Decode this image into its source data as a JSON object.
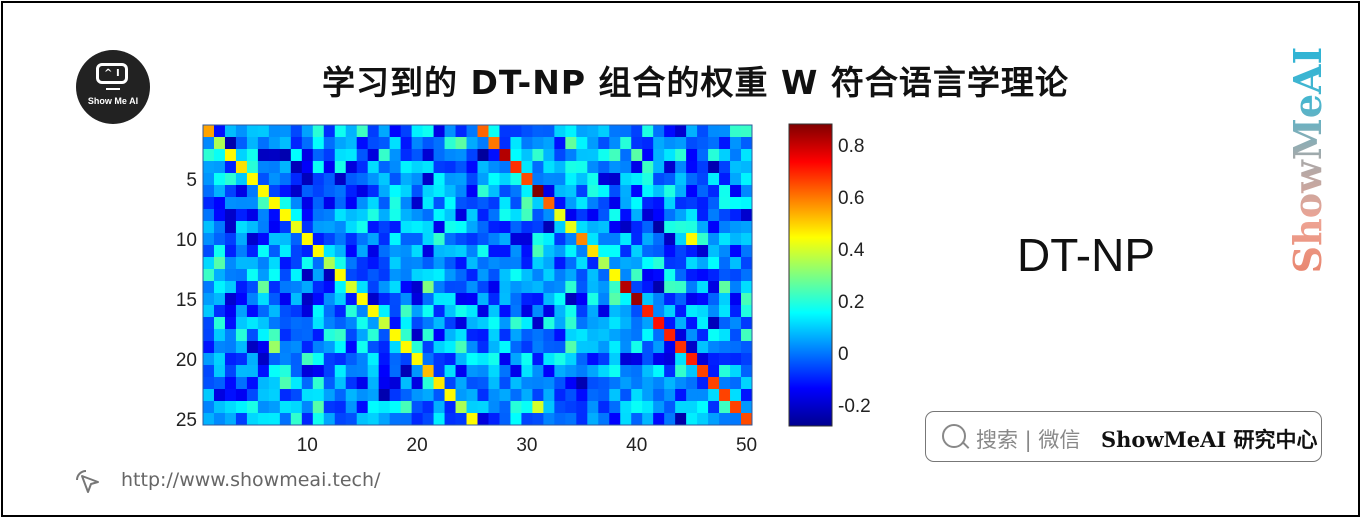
{
  "page": {
    "title": "学习到的 DT-NP 组合的权重 W 符合语言学理论",
    "side_label": "DT-NP",
    "brand_vertical": "ShowMeAI",
    "logo_text": "Show Me AI",
    "logo_face": "^ I",
    "search_hint": "搜索 | 微信",
    "search_name": "ShowMeAI 研究中心",
    "url": "http://www.showmeai.tech/",
    "icons": {
      "logo": "robot-monitor-icon",
      "search": "search-icon",
      "cursor": "cursor-click-icon"
    }
  },
  "chart_data": {
    "type": "heatmap",
    "title": "",
    "xlabel": "",
    "ylabel": "",
    "rows": 25,
    "cols": 50,
    "xticks": [
      10,
      20,
      30,
      40,
      50
    ],
    "yticks": [
      5,
      10,
      15,
      20,
      25
    ],
    "colorbar": {
      "colormap": "jet",
      "range": [
        -0.28,
        0.88
      ],
      "ticks": [
        0.8,
        0.6,
        0.4,
        0.2,
        0,
        -0.2
      ]
    },
    "diagonal_left": [
      0.55,
      0.35,
      0.45,
      0.48,
      0.45,
      0.45,
      0.45,
      0.45,
      0.42,
      0.45,
      0.45,
      0.35,
      0.45,
      0.4,
      0.45,
      0.45,
      0.38,
      0.45,
      0.45,
      0.45,
      0.52,
      0.47,
      0.45,
      0.35,
      0.45
    ],
    "diagonal_right": [
      0.62,
      0.6,
      0.82,
      0.68,
      0.65,
      0.88,
      0.62,
      0.42,
      0.42,
      0.58,
      0.48,
      0.35,
      0.45,
      0.82,
      0.85,
      0.7,
      0.72,
      0.7,
      0.68,
      0.7,
      0.66,
      0.66,
      0.66,
      0.66,
      0.65
    ],
    "offdiag_seed": 7,
    "offdiag_range": [
      -0.25,
      0.3
    ],
    "notable_cells": [
      {
        "row": 10,
        "col": 45,
        "value": 0.45
      },
      {
        "row": 19,
        "col": 7,
        "value": 0.33
      },
      {
        "row": 25,
        "col": 25,
        "value": 0.45
      },
      {
        "row": 24,
        "col": 31,
        "value": 0.4
      },
      {
        "row": 14,
        "col": 21,
        "value": 0.3
      }
    ]
  }
}
